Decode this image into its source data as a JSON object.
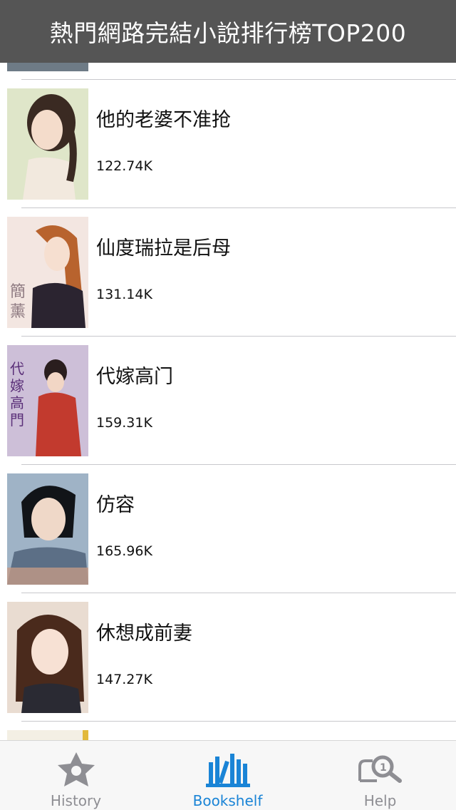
{
  "navbar": {
    "title": "熱門網路完結小說排行榜TOP200"
  },
  "books": [
    {
      "title": "他的老婆不准抢",
      "size": "122.74K"
    },
    {
      "title": "仙度瑞拉是后母",
      "size": "131.14K"
    },
    {
      "title": "代嫁高门",
      "size": "159.31K"
    },
    {
      "title": "仿容",
      "size": "165.96K"
    },
    {
      "title": "休想成前妻",
      "size": "147.27K"
    }
  ],
  "tabbar": {
    "tabs": [
      {
        "label": "History",
        "icon": "star-icon",
        "active": false
      },
      {
        "label": "Bookshelf",
        "icon": "bookshelf-icon",
        "active": true
      },
      {
        "label": "Help",
        "icon": "magnifier-help-icon",
        "active": false
      }
    ]
  },
  "colors": {
    "navbar": "#555555",
    "accent": "#1a84d6",
    "inactive": "#8e8e93"
  }
}
